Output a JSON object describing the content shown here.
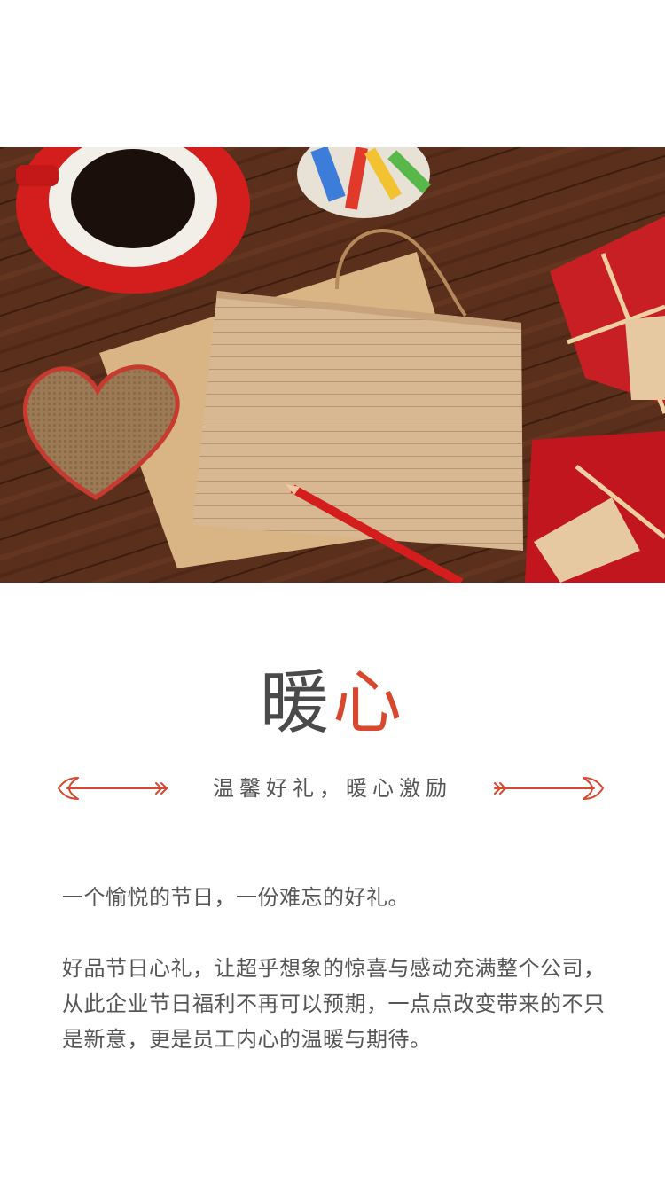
{
  "hero": {
    "image": "coffee-cup-kraft-notecard-heart-gift-boxes-photo"
  },
  "title": {
    "part1": "暖",
    "part2": "心",
    "accent_color": "#d9472f",
    "text_color": "#4a4a4a"
  },
  "subtitle": "温馨好礼，暖心激励",
  "paragraphs": [
    "一个愉悦的节日，一份难忘的好礼。",
    "好品节日心礼，让超乎想象的惊喜与感动充满整个公司，从此企业节日福利不再可以预期，一点点改变带来的不只是新意，更是员工内心的温暖与期待。"
  ]
}
